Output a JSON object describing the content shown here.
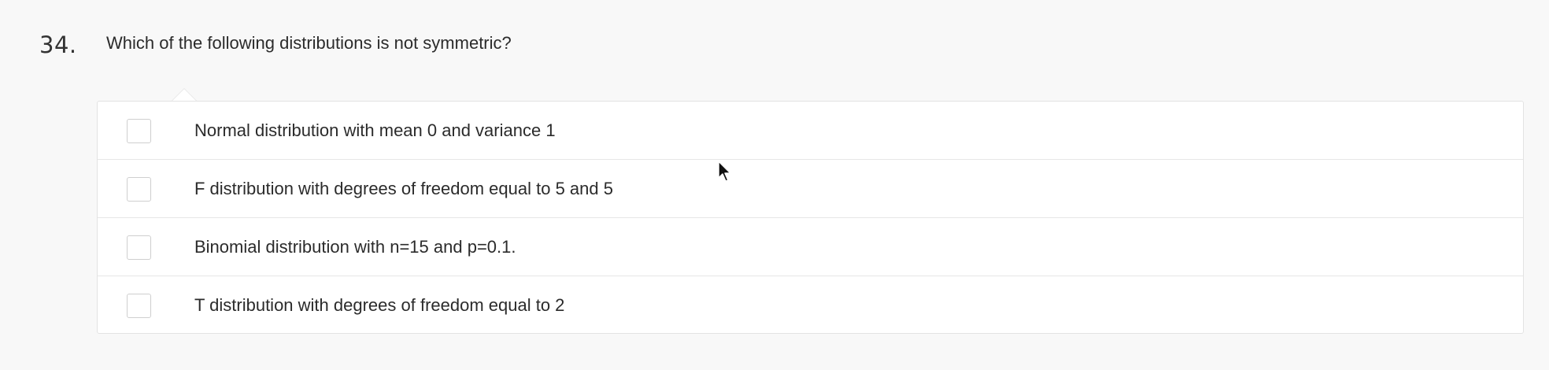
{
  "question": {
    "number": "34.",
    "text": "Which of the following distributions is not symmetric?"
  },
  "options": [
    {
      "label": "Normal distribution with mean 0 and variance 1",
      "checked": false
    },
    {
      "label": "F distribution with degrees of freedom equal to 5 and 5",
      "checked": false
    },
    {
      "label": "Binomial distribution with n=15 and p=0.1.",
      "checked": false
    },
    {
      "label": "T distribution with degrees of freedom equal to 2",
      "checked": false
    }
  ],
  "colors": {
    "page_background": "#f8f8f8",
    "panel_background": "#ffffff",
    "border": "#e3e3e3",
    "text": "#2b2b2b"
  }
}
